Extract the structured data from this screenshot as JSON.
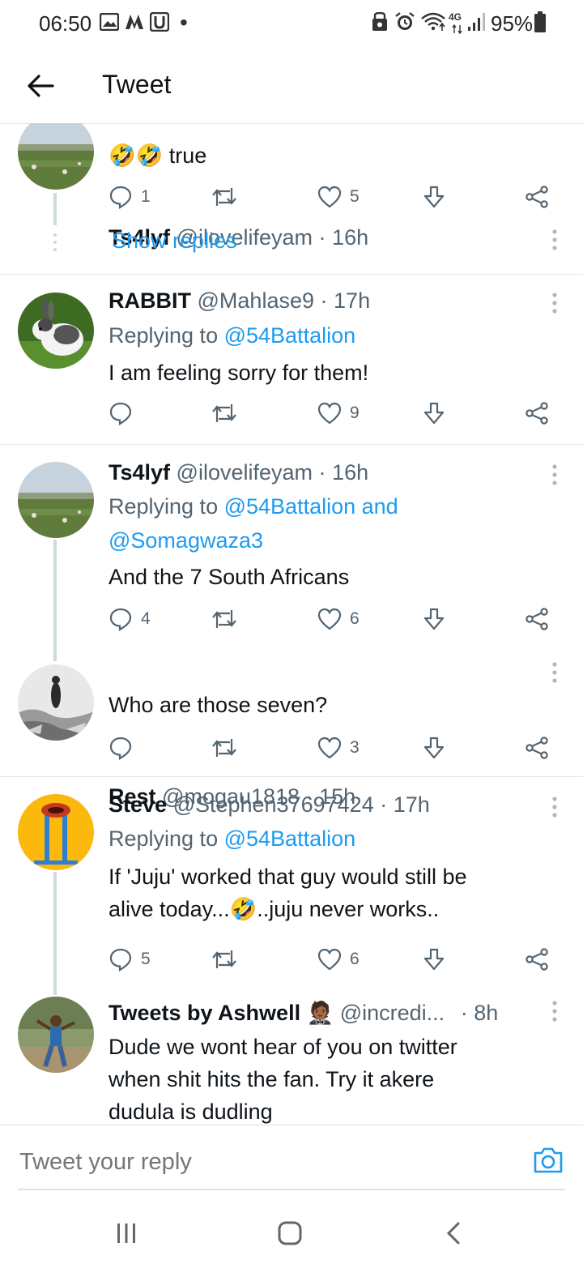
{
  "status_bar": {
    "time": "06:50",
    "battery": "95%",
    "network": "4G"
  },
  "header": {
    "title": "Tweet"
  },
  "tweets": [
    {
      "name": "Ts4lyf",
      "handle": "@ilovelifeyam",
      "time": "16h",
      "text": "true",
      "emoji": "🤣🤣",
      "replies": "1",
      "likes": "5",
      "show_replies": "Show replies"
    },
    {
      "name": "RABBIT",
      "handle": "@Mahlase9",
      "time": "17h",
      "replying_prefix": "Replying to",
      "replying_to": "@54Battalion",
      "text": "I am feeling sorry for them!",
      "replies": "",
      "likes": "9"
    },
    {
      "name": "Ts4lyf",
      "handle": "@ilovelifeyam",
      "time": "16h",
      "replying_prefix": "Replying to",
      "replying_to": "@54Battalion and",
      "replying_to_2": "@Somagwaza3",
      "text": "And the 7 South Africans",
      "replies": "4",
      "likes": "6"
    },
    {
      "name": "Rest",
      "handle": "@mogau1818",
      "time": "15h",
      "text": "Who are those seven?",
      "replies": "",
      "likes": "3"
    },
    {
      "name": "Steve",
      "handle": "@Stephen37697424",
      "time": "17h",
      "replying_prefix": "Replying to",
      "replying_to": "@54Battalion",
      "text_line1": "If 'Juju' worked that guy would still be",
      "text_line2a": "alive today...",
      "text_line2_emoji": "🤣",
      "text_line2b": "..juju never works..",
      "replies": "5",
      "likes": "6"
    },
    {
      "name": "Tweets by Ashwell",
      "name_emoji": "🤵🏾",
      "handle": "@incredi...",
      "time": "8h",
      "text_line1": "Dude we wont hear of you on twitter",
      "text_line2": "when shit hits the fan. Try it akere",
      "text_line3": "dudula is dudling"
    }
  ],
  "separator": "·",
  "reply_box": {
    "placeholder": "Tweet your reply"
  },
  "colors": {
    "accent": "#1d9bf0",
    "text": "#0f1419",
    "secondary": "#536471",
    "divider": "#e6e6e6"
  }
}
